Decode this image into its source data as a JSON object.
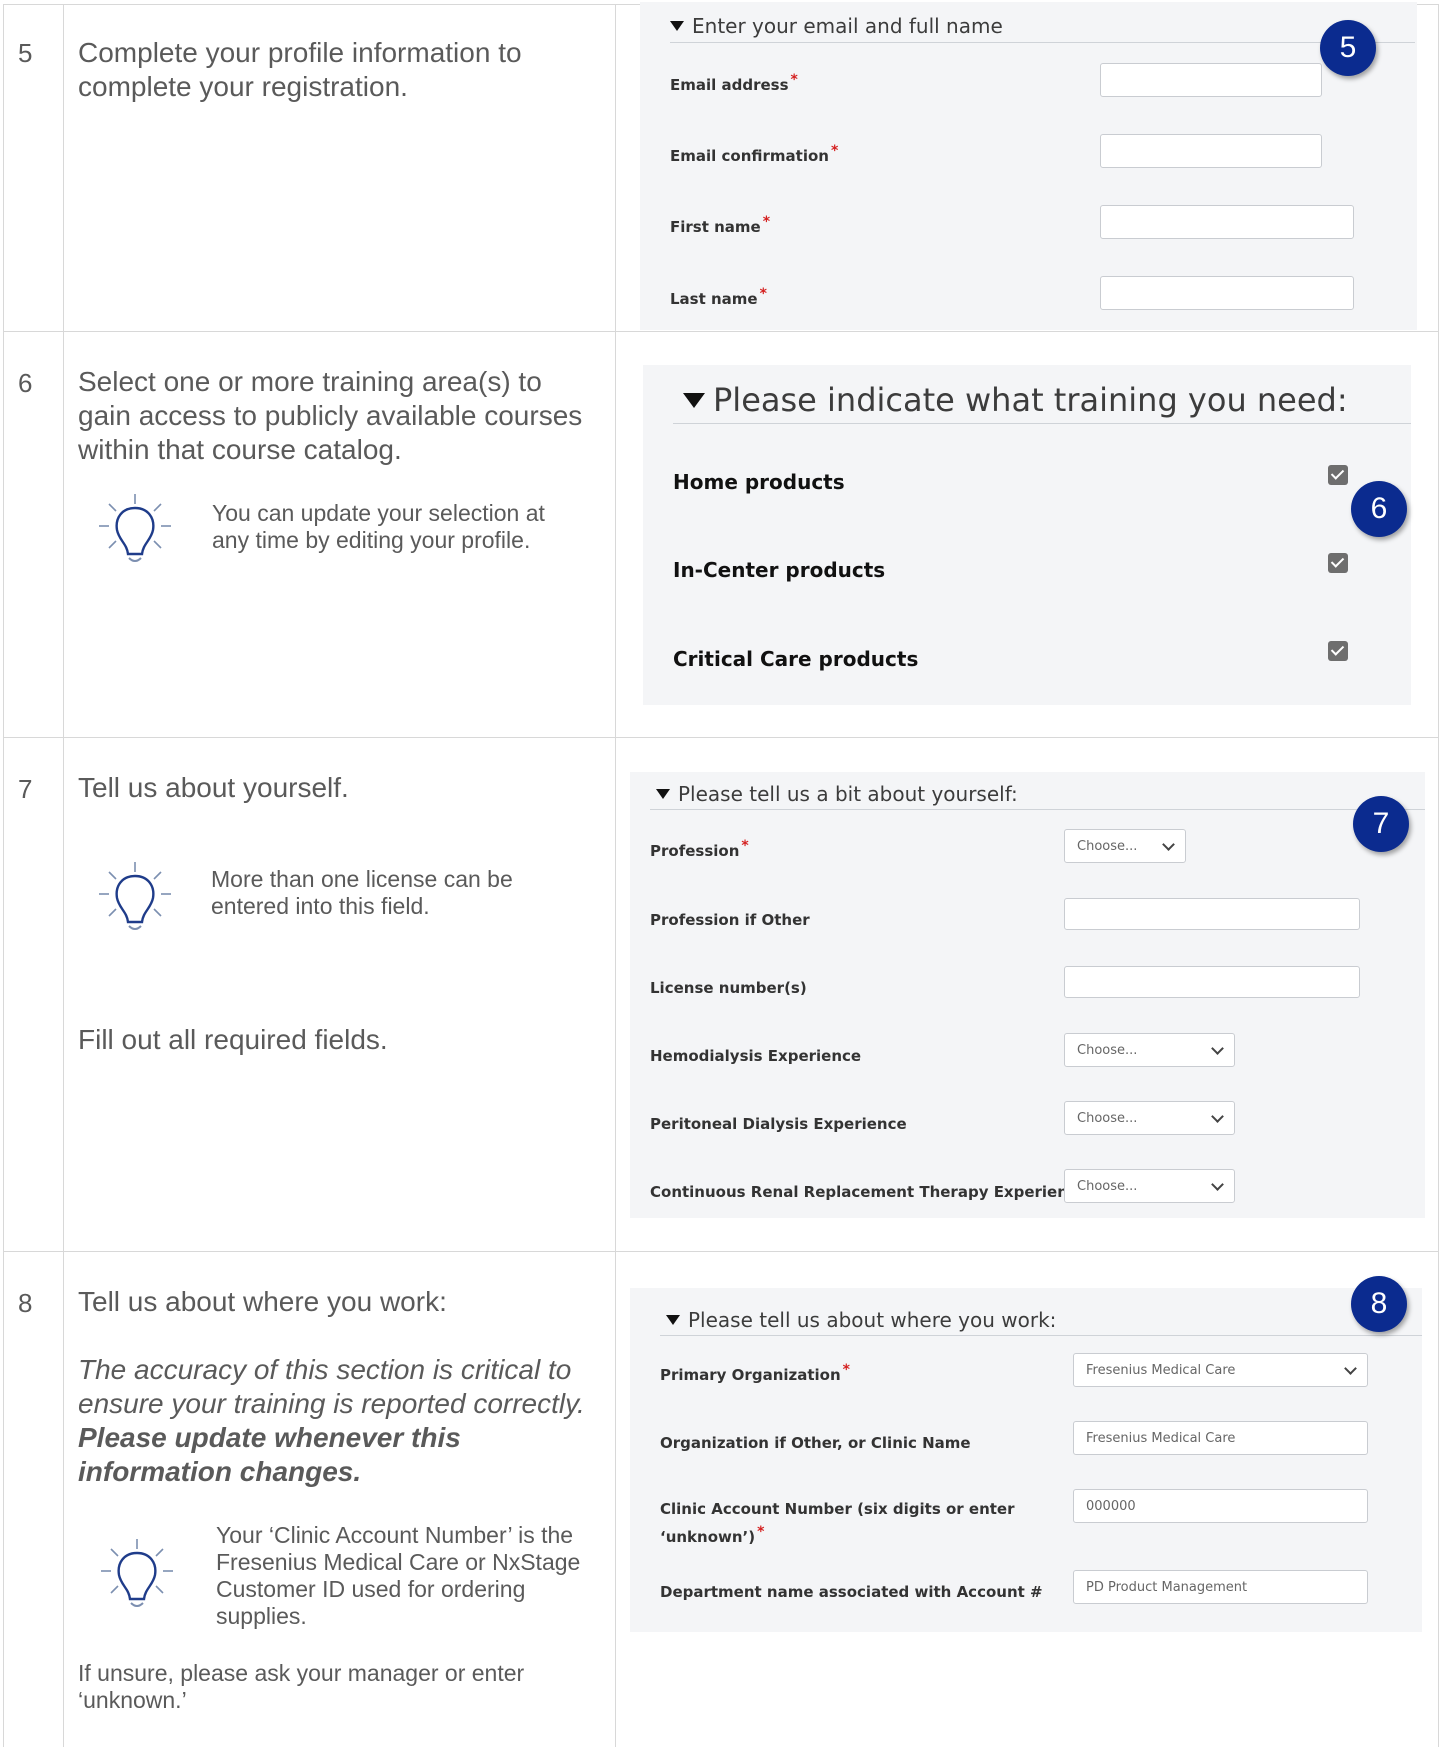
{
  "rows": [
    {
      "number": "5",
      "instruction": "Complete your profile information to complete your registration.",
      "panel": {
        "title": "Enter your email and full name",
        "badge": "5",
        "fields": [
          {
            "label": "Email address",
            "required": "*",
            "value": ""
          },
          {
            "label": "Email confirmation",
            "required": "*",
            "value": ""
          },
          {
            "label": "First name",
            "required": "*",
            "value": ""
          },
          {
            "label": "Last name",
            "required": "*",
            "value": ""
          }
        ]
      }
    },
    {
      "number": "6",
      "instruction": "Select one or more training area(s) to gain access to publicly available courses within that course catalog.",
      "tip": "You can update your selection at any time by editing your profile.",
      "panel": {
        "title": "Please indicate what training you need:",
        "badge": "6",
        "options": [
          {
            "label": "Home products",
            "checked": true
          },
          {
            "label": "In-Center products",
            "checked": true
          },
          {
            "label": "Critical Care products",
            "checked": true
          }
        ]
      }
    },
    {
      "number": "7",
      "instruction": "Tell us about yourself.",
      "tip": "More than one license can be entered into this field.",
      "instruction2": "Fill out all required fields.",
      "panel": {
        "title": "Please tell us a bit about yourself:",
        "badge": "7",
        "fields": [
          {
            "label": "Profession",
            "required": "*",
            "type": "select",
            "value": "Choose..."
          },
          {
            "label": "Profession if Other",
            "required": "",
            "type": "text",
            "value": ""
          },
          {
            "label": "License number(s)",
            "required": "",
            "type": "text",
            "value": ""
          },
          {
            "label": "Hemodialysis Experience",
            "required": "",
            "type": "select",
            "value": "Choose..."
          },
          {
            "label": "Peritoneal Dialysis Experience",
            "required": "",
            "type": "select",
            "value": "Choose..."
          },
          {
            "label": "Continuous Renal Replacement Therapy Experience",
            "required": "",
            "type": "select",
            "value": "Choose..."
          }
        ]
      }
    },
    {
      "number": "8",
      "instruction": "Tell us about where you work:",
      "emphasis_italic": "The accuracy of this section is critical to ensure your training is reported correctly.",
      "emphasis_bold": "Please update whenever this information changes.",
      "tip": "Your ‘Clinic Account Number’ is the Fresenius Medical Care or NxStage Customer ID used for ordering supplies.",
      "footer": "If unsure, please ask your manager or enter ‘unknown.’",
      "panel": {
        "title": "Please tell us about where you work:",
        "badge": "8",
        "fields": [
          {
            "label": "Primary Organization",
            "required": "*",
            "type": "select",
            "value": "Fresenius Medical Care"
          },
          {
            "label": "Organization if Other, or Clinic Name",
            "required": "",
            "type": "text",
            "value": "Fresenius Medical Care"
          },
          {
            "label": "Clinic Account Number (six digits or enter",
            "label2": "‘unknown’)",
            "required": "*",
            "type": "text",
            "value": "000000"
          },
          {
            "label": "Department name associated with Account #",
            "required": "",
            "type": "text",
            "value": "PD Product Management"
          }
        ]
      }
    }
  ]
}
